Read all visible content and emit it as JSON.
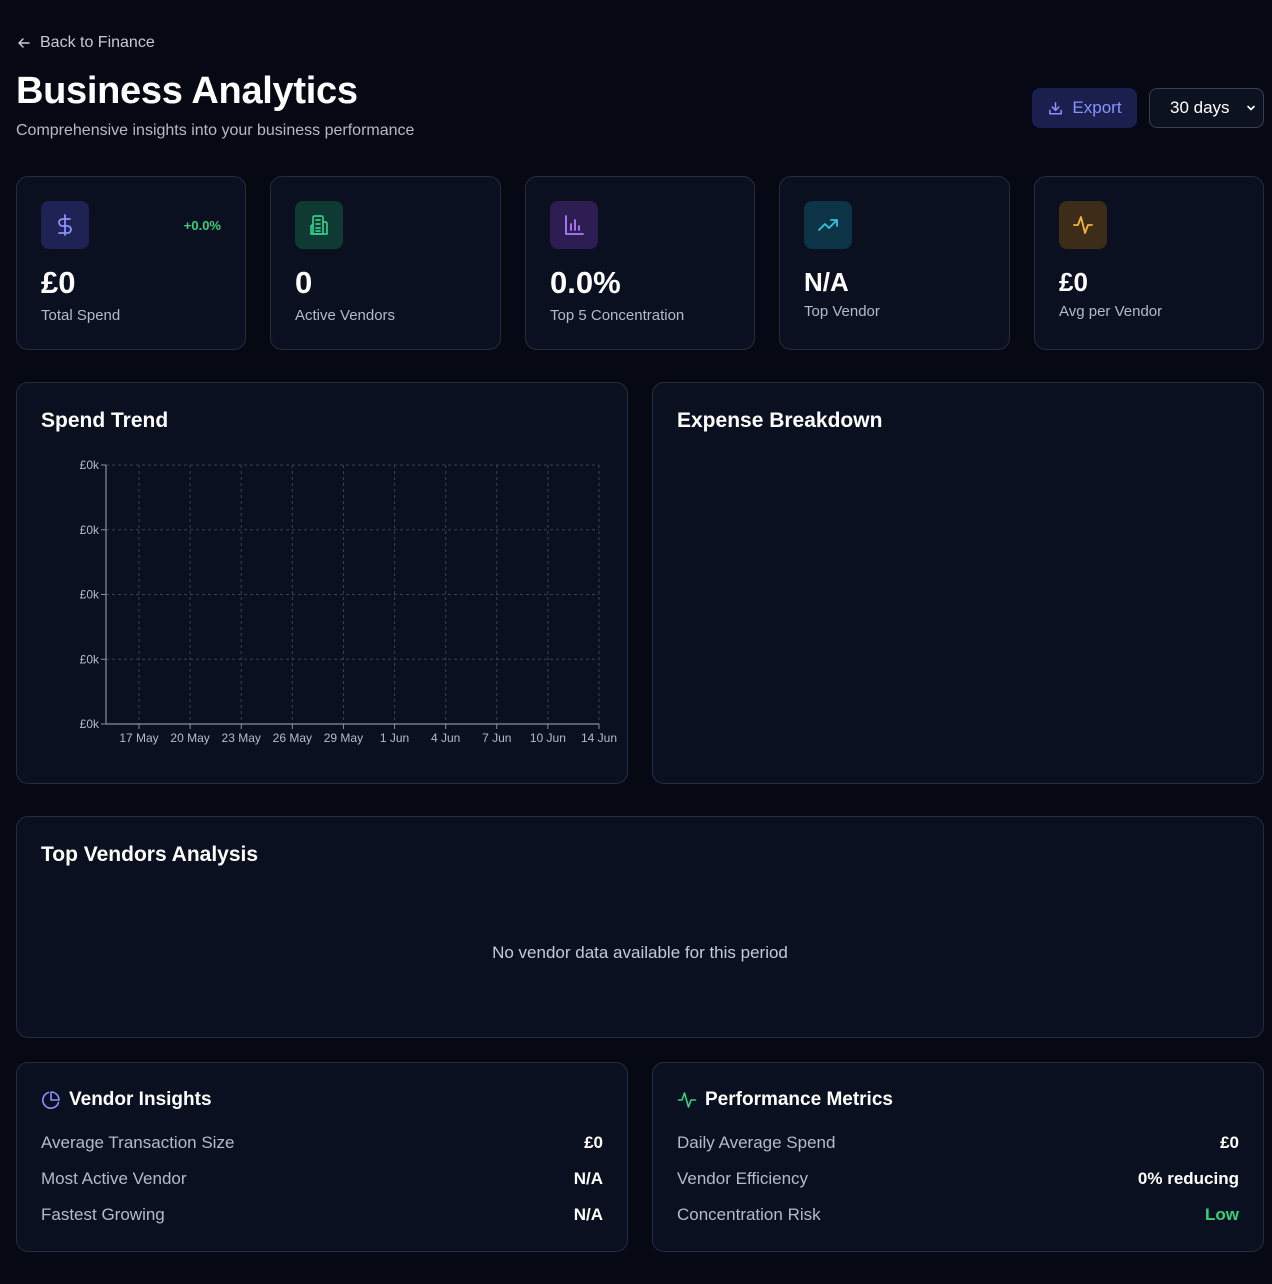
{
  "header": {
    "back_label": "Back to Finance",
    "title": "Business Analytics",
    "subtitle": "Comprehensive insights into your business performance",
    "export_label": "Export",
    "period_selected": "30 days"
  },
  "stats": [
    {
      "icon": "dollar-icon",
      "value": "£0",
      "label": "Total Spend",
      "change": "+0.0%",
      "color": "#8c91ff",
      "bg": "#1e2353"
    },
    {
      "icon": "building-icon",
      "value": "0",
      "label": "Active Vendors",
      "color": "#35c98a",
      "bg": "#0f3a33"
    },
    {
      "icon": "bar-chart-icon",
      "value": "0.0%",
      "label": "Top 5 Concentration",
      "color": "#b07cff",
      "bg": "#2d1d52"
    },
    {
      "icon": "trending-up-icon",
      "value": "N/A",
      "label": "Top Vendor",
      "color": "#2fc3dc",
      "bg": "#0c3346"
    },
    {
      "icon": "activity-icon",
      "value": "£0",
      "label": "Avg per Vendor",
      "color": "#f2b53a",
      "bg": "#3d2c17"
    }
  ],
  "spend_trend": {
    "title": "Spend Trend",
    "chart_data": {
      "type": "line",
      "x": [
        "17 May",
        "20 May",
        "23 May",
        "26 May",
        "29 May",
        "1 Jun",
        "4 Jun",
        "7 Jun",
        "10 Jun",
        "14 Jun"
      ],
      "y_tick_labels": [
        "£0k",
        "£0k",
        "£0k",
        "£0k",
        "£0k"
      ],
      "series": [],
      "grid": true
    }
  },
  "expense_breakdown": {
    "title": "Expense Breakdown"
  },
  "top_vendors": {
    "title": "Top Vendors Analysis",
    "empty_message": "No vendor data available for this period"
  },
  "vendor_insights": {
    "title": "Vendor Insights",
    "rows": [
      {
        "label": "Average Transaction Size",
        "value": "£0"
      },
      {
        "label": "Most Active Vendor",
        "value": "N/A"
      },
      {
        "label": "Fastest Growing",
        "value": "N/A"
      }
    ]
  },
  "performance_metrics": {
    "title": "Performance Metrics",
    "rows": [
      {
        "label": "Daily Average Spend",
        "value": "£0"
      },
      {
        "label": "Vendor Efficiency",
        "value": "0% reducing"
      },
      {
        "label": "Concentration Risk",
        "value": "Low"
      }
    ]
  },
  "colors": {
    "background": "#060914",
    "card": "#0b1020",
    "accent": "#8c91ff",
    "positive": "#36d07a"
  }
}
